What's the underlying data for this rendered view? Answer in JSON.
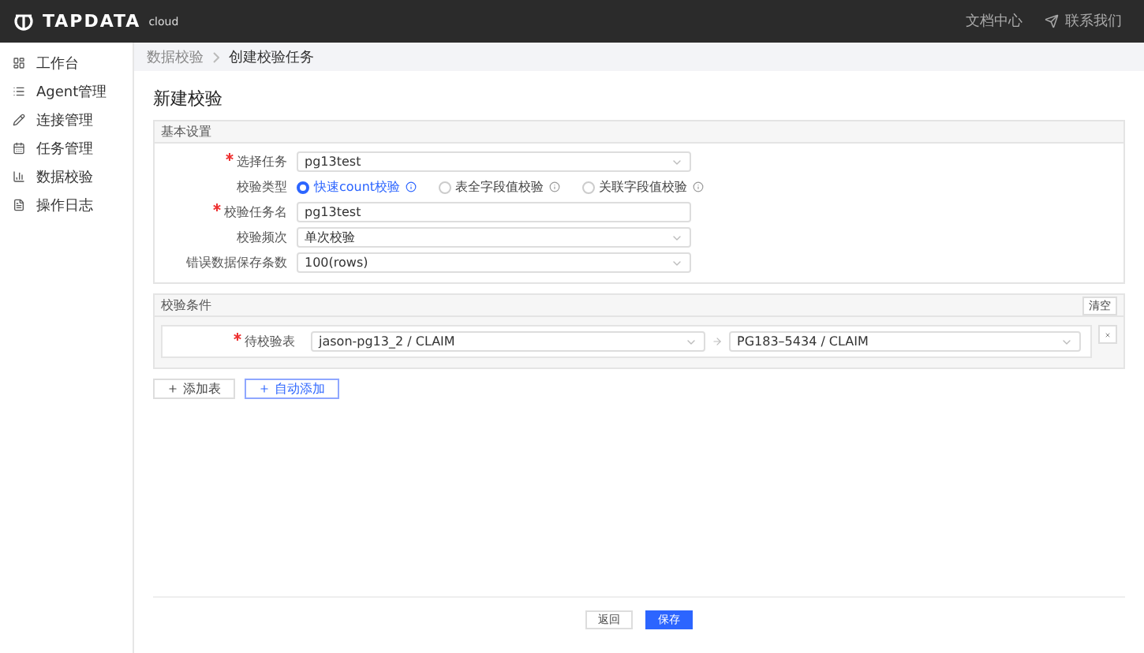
{
  "header": {
    "logo": "TAPDATA",
    "logo_suffix": "cloud",
    "links": [
      {
        "label": "文档中心"
      },
      {
        "label": "联系我们"
      }
    ]
  },
  "sidebar": {
    "items": [
      {
        "label": "工作台"
      },
      {
        "label": "Agent管理"
      },
      {
        "label": "连接管理"
      },
      {
        "label": "任务管理"
      },
      {
        "label": "数据校验"
      },
      {
        "label": "操作日志"
      }
    ]
  },
  "breadcrumb": [
    "数据校验",
    "创建校验任务"
  ],
  "page_title": "新建校验",
  "basic_settings": {
    "title": "基本设置",
    "fields": [
      {
        "kind": "select",
        "label": "选择任务",
        "required": true,
        "value": "pg13test"
      },
      {
        "kind": "radio",
        "label": "校验类型",
        "required": false,
        "options": [
          {
            "label": "快速count校验",
            "selected": true
          },
          {
            "label": "表全字段值校验",
            "selected": false
          },
          {
            "label": "关联字段值校验",
            "selected": false
          }
        ]
      },
      {
        "kind": "input",
        "label": "校验任务名",
        "required": true,
        "value": "pg13test"
      },
      {
        "kind": "select",
        "label": "校验频次",
        "required": false,
        "value": "单次校验"
      },
      {
        "kind": "select",
        "label": "错误数据保存条数",
        "required": false,
        "value": "100(rows)"
      }
    ]
  },
  "conditions": {
    "title": "校验条件",
    "clear_button": "清空",
    "rows": [
      {
        "label": "待校验表",
        "required": true,
        "source": "jason-pg13_2 / CLAIM",
        "target": "PG183–5434 / CLAIM"
      }
    ]
  },
  "actions": [
    {
      "label": "添加表",
      "primary": false
    },
    {
      "label": "自动添加",
      "primary": true
    }
  ],
  "footer": [
    {
      "label": "返回",
      "primary": false
    },
    {
      "label": "保存",
      "primary": true
    }
  ]
}
